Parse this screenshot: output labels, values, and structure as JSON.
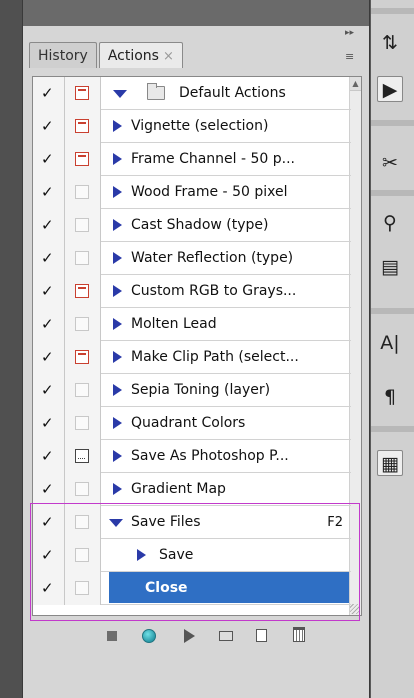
{
  "tabs": [
    {
      "label": "History",
      "active": false
    },
    {
      "label": "Actions",
      "active": true,
      "close_glyph": "×"
    }
  ],
  "panel_menu_glyph": "≡",
  "collapse_glyph": "▸▸",
  "actions": [
    {
      "label": "Default Actions",
      "checked": true,
      "dialog": "red",
      "type": "set",
      "expanded": true
    },
    {
      "label": "Vignette (selection)",
      "checked": true,
      "dialog": "red",
      "type": "action"
    },
    {
      "label": "Frame Channel - 50 p...",
      "checked": true,
      "dialog": "red",
      "type": "action"
    },
    {
      "label": "Wood Frame - 50 pixel",
      "checked": true,
      "dialog": "none",
      "type": "action"
    },
    {
      "label": "Cast Shadow (type)",
      "checked": true,
      "dialog": "none",
      "type": "action"
    },
    {
      "label": "Water Reflection (type)",
      "checked": true,
      "dialog": "none",
      "type": "action"
    },
    {
      "label": "Custom RGB to Grays...",
      "checked": true,
      "dialog": "red",
      "type": "action"
    },
    {
      "label": "Molten Lead",
      "checked": true,
      "dialog": "none",
      "type": "action"
    },
    {
      "label": "Make Clip Path (select...",
      "checked": true,
      "dialog": "red",
      "type": "action"
    },
    {
      "label": "Sepia Toning (layer)",
      "checked": true,
      "dialog": "none",
      "type": "action"
    },
    {
      "label": "Quadrant Colors",
      "checked": true,
      "dialog": "none",
      "type": "action"
    },
    {
      "label": "Save As Photoshop P...",
      "checked": true,
      "dialog": "dark",
      "type": "action"
    },
    {
      "label": "Gradient Map",
      "checked": true,
      "dialog": "none",
      "type": "action"
    },
    {
      "label": "Save Files",
      "checked": true,
      "dialog": "none",
      "type": "action",
      "expanded": true,
      "shortcut": "F2"
    },
    {
      "label": "Save",
      "checked": true,
      "dialog": "none",
      "type": "step"
    },
    {
      "label": "Close",
      "checked": true,
      "dialog": "none",
      "type": "step",
      "selected": true
    }
  ],
  "toolbar": {
    "stop": "stop-button",
    "record": "record-button",
    "play": "play-button",
    "new_set": "new-set-button",
    "new_action": "new-action-button",
    "delete": "delete-button"
  },
  "right_tools": [
    "history-brush-icon",
    "play-panel-icon",
    "tools-icon",
    "clone-source-icon",
    "paste-icon",
    "character-icon",
    "paragraph-icon",
    "notes-icon"
  ],
  "right_glyphs": {
    "history-brush-icon": "⇅",
    "play-panel-icon": "▶",
    "tools-icon": "✂",
    "clone-source-icon": "⚲",
    "paste-icon": "▤",
    "character-icon": "A|",
    "paragraph-icon": "¶",
    "notes-icon": "▦"
  },
  "colors": {
    "selection": "#2f6fc4",
    "expand_arrow": "#2a3aa8",
    "dialog_red": "#c94030",
    "highlight_outline": "#c23acb"
  }
}
